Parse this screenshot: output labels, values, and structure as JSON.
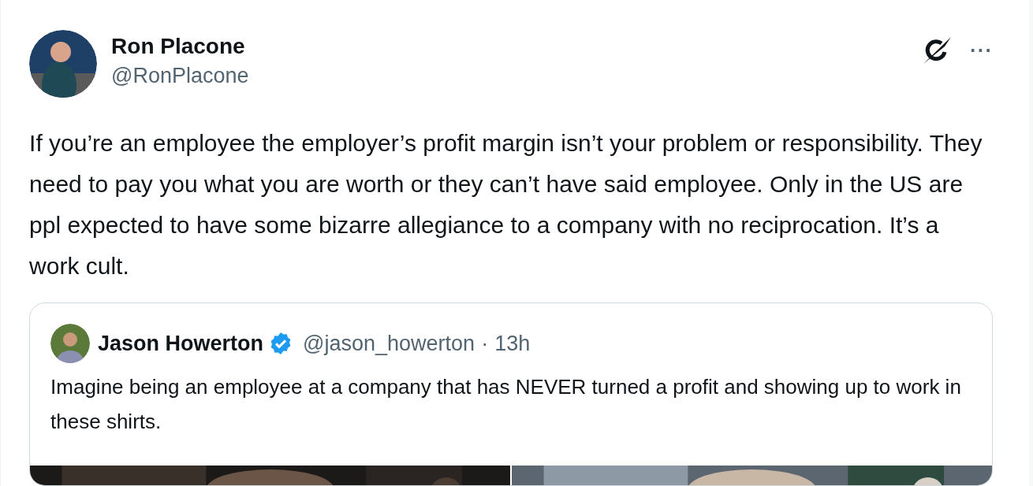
{
  "author": {
    "name": "Ron Placone",
    "handle": "@RonPlacone"
  },
  "text": "If you’re an employee the employer’s profit margin isn’t your problem or responsibility. They need to pay you what you are worth or they can’t have said employee. Only in the US are ppl expected to have some bizarre allegiance to a company with no reciprocation. It’s a work cult.",
  "more_label": "···",
  "quote": {
    "name": "Jason Howerton",
    "verified": true,
    "handle": "@jason_howerton",
    "separator": "·",
    "time": "13h",
    "text": "Imagine being an employee at a company that has NEVER turned a profit and showing up to work in these shirts."
  }
}
